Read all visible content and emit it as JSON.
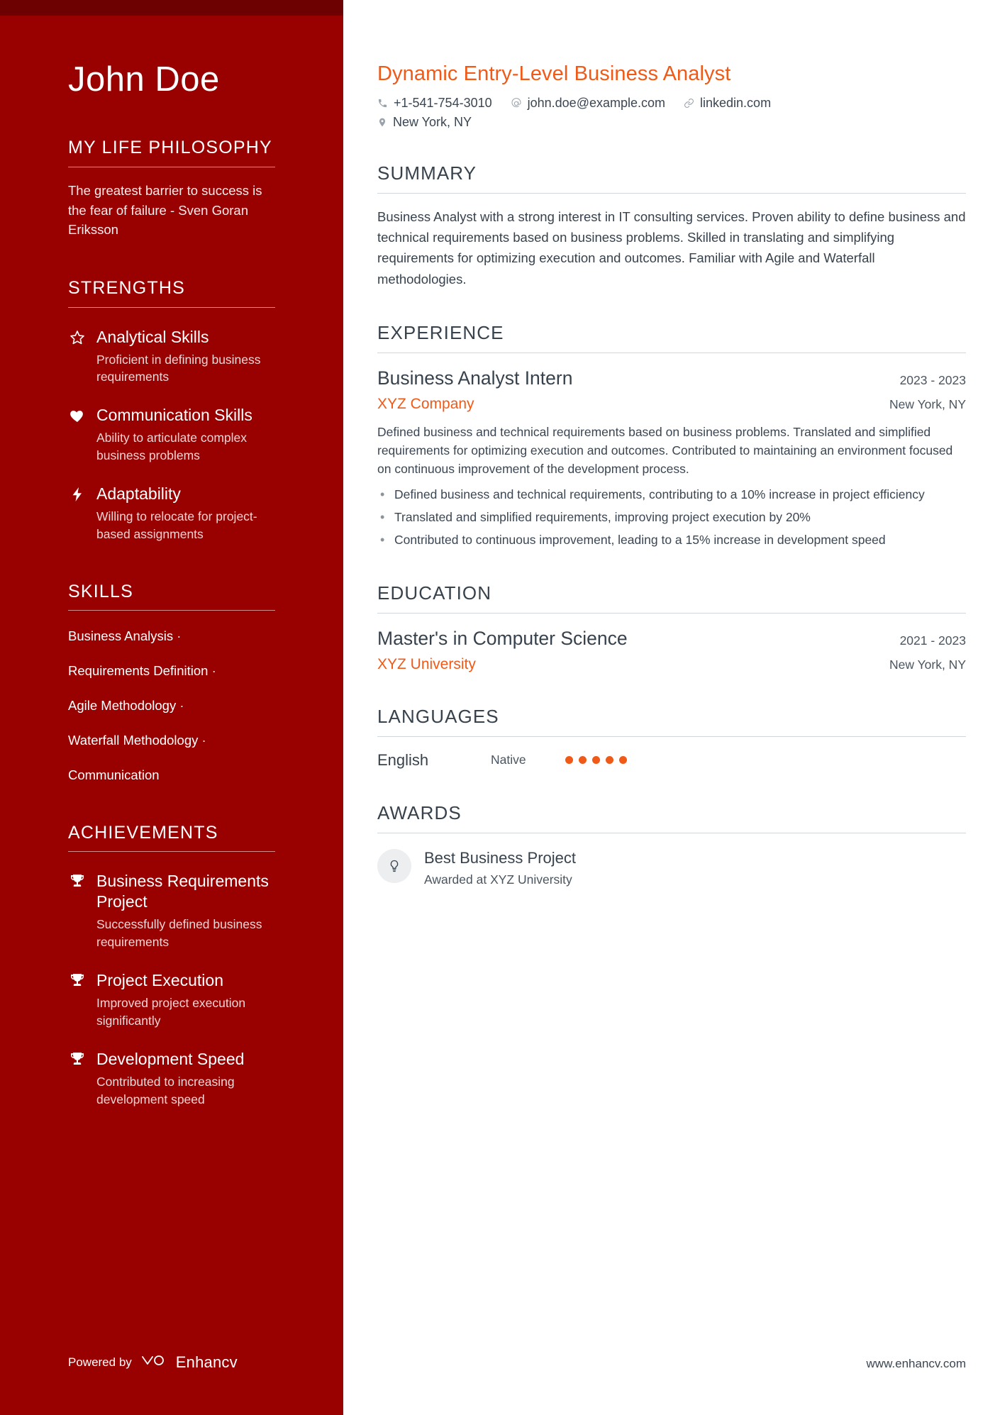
{
  "theme": {
    "sidebar_bg": "#990000",
    "sidebar_top_strip": "#6d0000",
    "accent": "#f05a18",
    "text": "#37424d"
  },
  "sidebar": {
    "name": "John Doe",
    "philosophy": {
      "heading": "MY LIFE PHILOSOPHY",
      "quote": "The greatest barrier to success is the fear of failure - Sven Goran Eriksson"
    },
    "strengths": {
      "heading": "STRENGTHS",
      "items": [
        {
          "icon": "star-icon",
          "title": "Analytical Skills",
          "desc": "Proficient in defining business requirements"
        },
        {
          "icon": "heart-icon",
          "title": "Communication Skills",
          "desc": "Ability to articulate complex business problems"
        },
        {
          "icon": "bolt-icon",
          "title": "Adaptability",
          "desc": "Willing to relocate for project-based assignments"
        }
      ]
    },
    "skills": {
      "heading": "SKILLS",
      "items": [
        {
          "label": "Business Analysis",
          "sep": "·"
        },
        {
          "label": "Requirements Definition",
          "sep": "·"
        },
        {
          "label": "Agile Methodology",
          "sep": "·"
        },
        {
          "label": "Waterfall Methodology",
          "sep": "·"
        },
        {
          "label": "Communication",
          "sep": ""
        }
      ]
    },
    "achievements": {
      "heading": "ACHIEVEMENTS",
      "items": [
        {
          "icon": "trophy-icon",
          "title": "Business Requirements Project",
          "desc": "Successfully defined business requirements"
        },
        {
          "icon": "trophy-icon",
          "title": "Project Execution",
          "desc": "Improved project execution significantly"
        },
        {
          "icon": "trophy-icon",
          "title": "Development Speed",
          "desc": "Contributed to increasing development speed"
        }
      ]
    },
    "footer": {
      "powered_label": "Powered by",
      "brand": "Enhancv"
    }
  },
  "main": {
    "headline": "Dynamic Entry-Level Business Analyst",
    "contacts": [
      {
        "icon": "phone-icon",
        "value": "+1-541-754-3010"
      },
      {
        "icon": "at-icon",
        "value": "john.doe@example.com"
      },
      {
        "icon": "link-icon",
        "value": "linkedin.com"
      },
      {
        "icon": "pin-icon",
        "value": "New York, NY"
      }
    ],
    "summary": {
      "heading": "SUMMARY",
      "text": "Business Analyst with a strong interest in IT consulting services. Proven ability to define business and technical requirements based on business problems. Skilled in translating and simplifying requirements for optimizing execution and outcomes. Familiar with Agile and Waterfall methodologies."
    },
    "experience": {
      "heading": "EXPERIENCE",
      "items": [
        {
          "title": "Business Analyst Intern",
          "dates": "2023 - 2023",
          "org": "XYZ Company",
          "location": "New York, NY",
          "desc": "Defined business and technical requirements based on business problems. Translated and simplified requirements for optimizing execution and outcomes. Contributed to maintaining an environment focused on continuous improvement of the development process.",
          "bullets": [
            "Defined business and technical requirements, contributing to a 10% increase in project efficiency",
            "Translated and simplified requirements, improving project execution by 20%",
            "Contributed to continuous improvement, leading to a 15% increase in development speed"
          ]
        }
      ]
    },
    "education": {
      "heading": "EDUCATION",
      "items": [
        {
          "title": "Master's in Computer Science",
          "dates": "2021 - 2023",
          "org": "XYZ University",
          "location": "New York, NY"
        }
      ]
    },
    "languages": {
      "heading": "LANGUAGES",
      "items": [
        {
          "name": "English",
          "level": "Native",
          "rating": 5,
          "max": 5
        }
      ]
    },
    "awards": {
      "heading": "AWARDS",
      "items": [
        {
          "icon": "bulb-icon",
          "title": "Best Business Project",
          "sub": "Awarded at XYZ University"
        }
      ]
    },
    "website": "www.enhancv.com"
  }
}
